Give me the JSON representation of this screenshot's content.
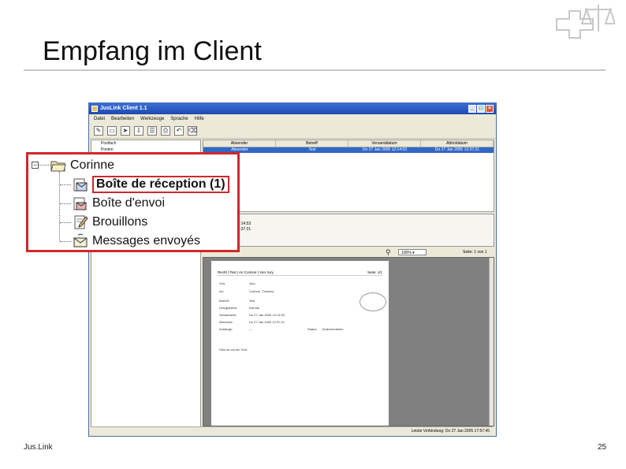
{
  "slide": {
    "title": "Empfang im Client",
    "footer_left": "Jus.Link",
    "page_number": "25"
  },
  "app": {
    "title": "JusLink Client 1.1",
    "menu": [
      "Datei",
      "Bearbeiten",
      "Werkzeuge",
      "Sprache",
      "Hilfe"
    ],
    "folders_left": [
      "Postfach",
      "Posten"
    ],
    "list_columns": [
      "Absender",
      "Betreff",
      "Versanddatum",
      "Abholdatum"
    ],
    "list_row": {
      "sender": "Absender",
      "subject": "Test",
      "sent": "Do 27 Jan 2005 12:14:53",
      "received": "Do 27 Jan 2005 12:37:21"
    },
    "meta_lines": [
      "Test",
      "Do 27 Jan 2005 12:14:53",
      "Do 27 Jan 2005 12:37:21",
      "Empfangen"
    ],
    "zoom": "100%",
    "page_label": "Seite: 1 von 1",
    "status_text": "Letzte Verbindung: Do 27 Jan 2005 17:57:45"
  },
  "receipt": {
    "header_left": "Recht | Test | An Corinne | Von Jury",
    "header_right": "Seite: 1/1",
    "rows": [
      {
        "k": "Von:",
        "v": "Jury"
      },
      {
        "k": "An:",
        "v": "Corinne, Thowrey"
      },
      {
        "k": "Betreff:",
        "v": "Test"
      },
      {
        "k": "Dringlichkeit:",
        "v": "Normal"
      },
      {
        "k": "Versandzeit:",
        "v": "Do 27 Jan 2005 12:14:53"
      },
      {
        "k": "Abholzeit:",
        "v": "Do 27 Jan 2005 12:37:21"
      },
      {
        "k": "Anhänge:",
        "v": "---"
      }
    ],
    "status_label": "Status:",
    "status_value": "Unterschrieben",
    "body": "Dies ist nur ein Test."
  },
  "callout": {
    "root": "Corinne",
    "items": [
      "Boîte de réception (1)",
      "Boîte d'envoi",
      "Brouillons",
      "Messages envoyés"
    ]
  },
  "colors": {
    "highlight_red": "#d0282a",
    "titlebar_blue": "#1d4ab0",
    "selection_blue": "#3168c6"
  }
}
